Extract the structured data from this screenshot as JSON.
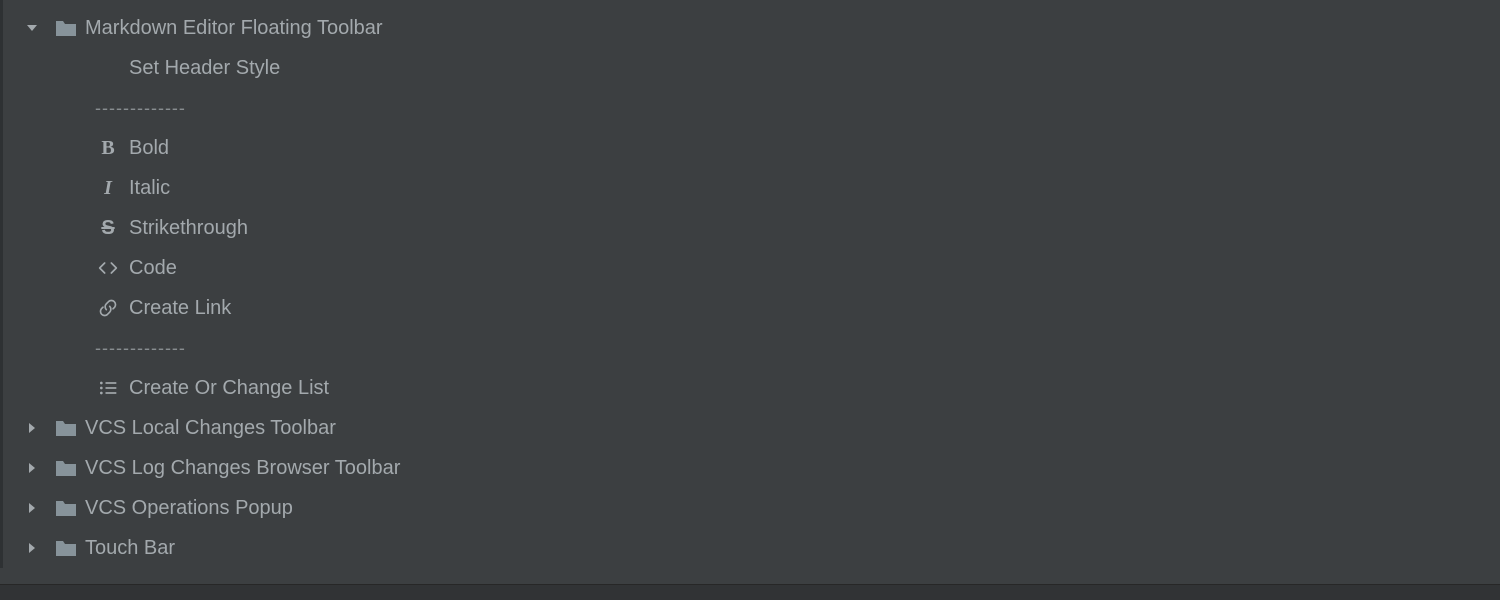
{
  "tree": {
    "folders": [
      {
        "name": "Markdown Editor Floating Toolbar",
        "expanded": true,
        "children": [
          {
            "type": "item",
            "label": "Set Header Style",
            "icon": "none"
          },
          {
            "type": "separator",
            "label": "-------------"
          },
          {
            "type": "item",
            "label": "Bold",
            "icon": "bold"
          },
          {
            "type": "item",
            "label": "Italic",
            "icon": "italic"
          },
          {
            "type": "item",
            "label": "Strikethrough",
            "icon": "strike"
          },
          {
            "type": "item",
            "label": "Code",
            "icon": "code"
          },
          {
            "type": "item",
            "label": "Create Link",
            "icon": "link"
          },
          {
            "type": "separator",
            "label": "-------------"
          },
          {
            "type": "item",
            "label": "Create Or Change List",
            "icon": "list"
          }
        ]
      },
      {
        "name": "VCS Local Changes Toolbar",
        "expanded": false
      },
      {
        "name": "VCS Log Changes Browser Toolbar",
        "expanded": false
      },
      {
        "name": "VCS Operations Popup",
        "expanded": false
      },
      {
        "name": "Touch Bar",
        "expanded": false
      }
    ]
  }
}
